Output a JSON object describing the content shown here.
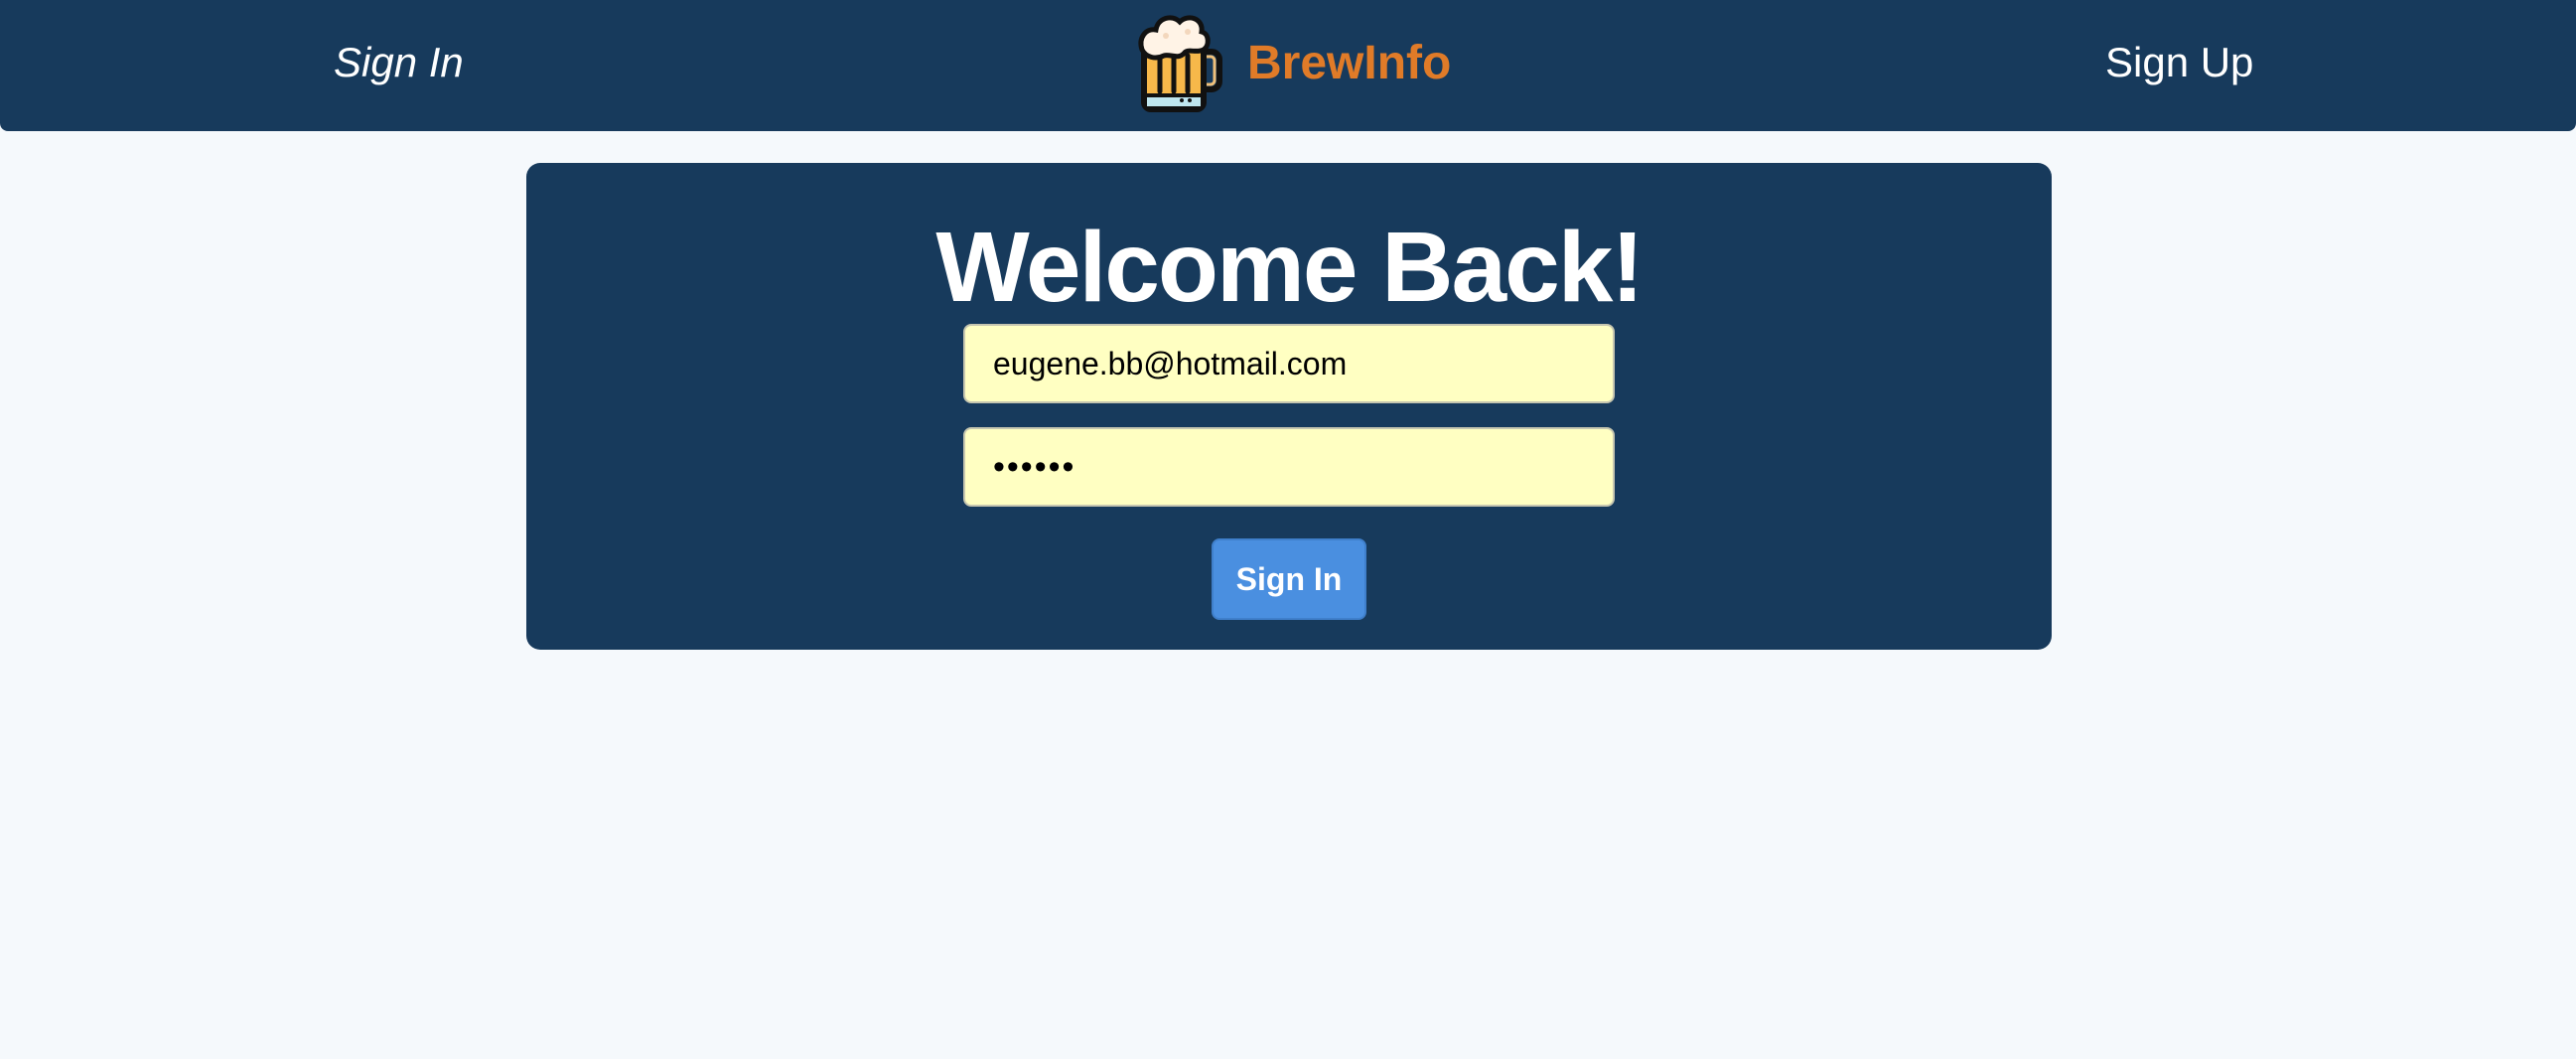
{
  "nav": {
    "sign_in_label": "Sign In",
    "sign_up_label": "Sign Up",
    "brand_name": "BrewInfo",
    "brand_icon": "beer-mug-icon"
  },
  "login": {
    "title": "Welcome Back!",
    "email_value": "eugene.bb@hotmail.com",
    "password_value": "123456",
    "submit_label": "Sign In"
  },
  "colors": {
    "navbar_bg": "#173a5c",
    "page_bg": "#f5f9fc",
    "brand_text": "#e07b28",
    "input_bg": "#ffffc2",
    "button_bg": "#4a8fe0"
  }
}
